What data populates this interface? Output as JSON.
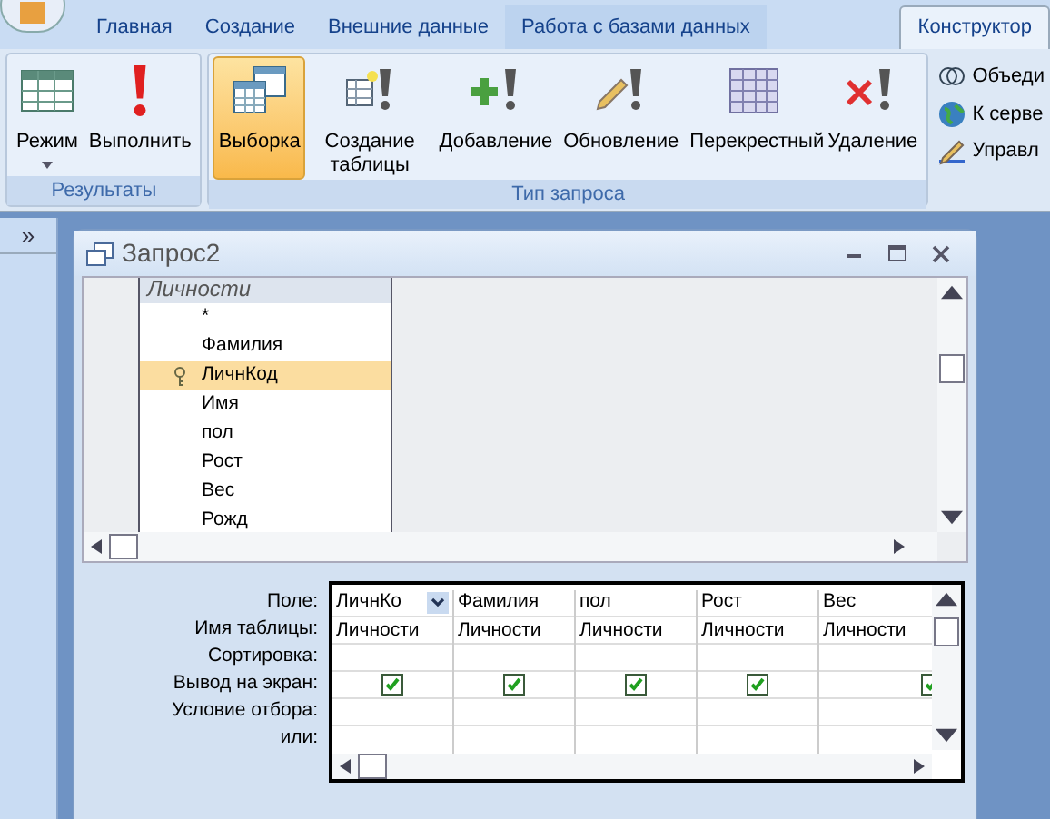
{
  "ribbon_tabs": [
    {
      "label": "Главная",
      "selected": false
    },
    {
      "label": "Создание",
      "selected": false
    },
    {
      "label": "Внешние данные",
      "selected": false
    },
    {
      "label": "Работа с базами данных",
      "selected": false
    },
    {
      "label": "Конструктор",
      "selected": true
    }
  ],
  "ribbon_groups": [
    {
      "title": "Результаты",
      "buttons": [
        {
          "label": "Режим",
          "selected": false
        },
        {
          "label": "Выполнить",
          "selected": false
        }
      ]
    },
    {
      "title": "Тип запроса",
      "buttons": [
        {
          "label": "Выборка",
          "selected": true
        },
        {
          "label": "Создание таблицы",
          "selected": false
        },
        {
          "label": "Добавление",
          "selected": false
        },
        {
          "label": "Обновление",
          "selected": false
        },
        {
          "label": "Перекрестный",
          "selected": false
        },
        {
          "label": "Удаление",
          "selected": false
        }
      ]
    }
  ],
  "ribbon_small_buttons": [
    {
      "label": "Объеди"
    },
    {
      "label": "К серве"
    },
    {
      "label": "Управл"
    }
  ],
  "nav_toggle": "»",
  "window": {
    "title": "Запрос2"
  },
  "table_box": {
    "title": "Личности",
    "fields": [
      {
        "name": "*",
        "key": false,
        "selected": false
      },
      {
        "name": "Фамилия",
        "key": false,
        "selected": false
      },
      {
        "name": "ЛичнКод",
        "key": true,
        "selected": true
      },
      {
        "name": "Имя",
        "key": false,
        "selected": false
      },
      {
        "name": "пол",
        "key": false,
        "selected": false
      },
      {
        "name": "Рост",
        "key": false,
        "selected": false
      },
      {
        "name": "Вес",
        "key": false,
        "selected": false
      },
      {
        "name": "Рожд",
        "key": false,
        "selected": false
      }
    ]
  },
  "grid": {
    "row_labels": [
      "Поле:",
      "Имя таблицы:",
      "Сортировка:",
      "Вывод на экран:",
      "Условие отбора:",
      "или:"
    ],
    "columns": [
      {
        "field": "ЛичнКо",
        "table": "Личности",
        "show": true,
        "selected": true
      },
      {
        "field": "Фамилия",
        "table": "Личности",
        "show": true,
        "selected": false
      },
      {
        "field": "пол",
        "table": "Личности",
        "show": true,
        "selected": false
      },
      {
        "field": "Рост",
        "table": "Личности",
        "show": true,
        "selected": false
      },
      {
        "field": "Вес",
        "table": "Личности",
        "show": true,
        "selected": false
      }
    ]
  }
}
